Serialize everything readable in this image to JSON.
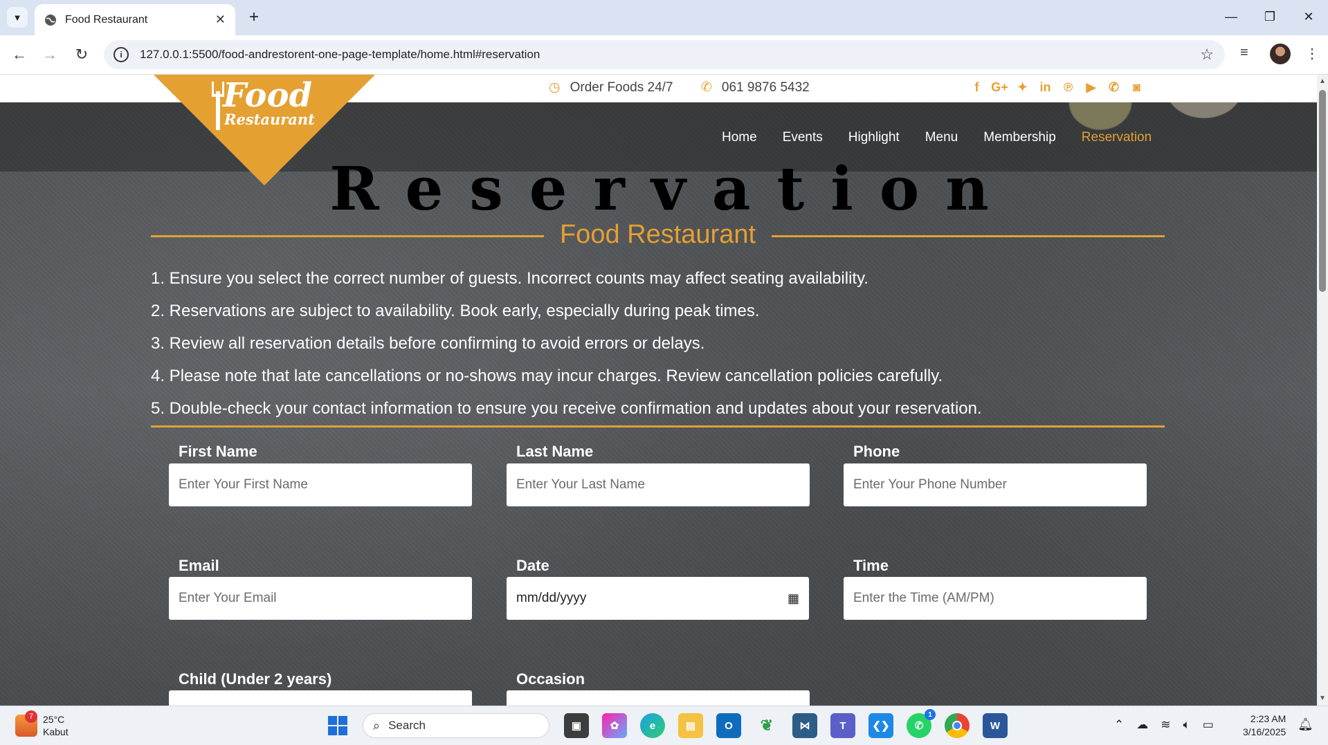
{
  "browser": {
    "tab_title": "Food Restaurant",
    "url": "127.0.0.1:5500/food-andrestorent-one-page-template/home.html#reservation"
  },
  "site": {
    "logo_word1": "Food",
    "logo_word2": "Restaurant",
    "topbar": {
      "order_text": "Order Foods 24/7",
      "phone": "061 9876 5432"
    },
    "social_icons": [
      "facebook-icon",
      "google-plus-icon",
      "twitter-icon",
      "linkedin-icon",
      "pinterest-icon",
      "youtube-icon",
      "phone-icon",
      "camera-icon"
    ],
    "nav": [
      "Home",
      "Events",
      "Highlight",
      "Menu",
      "Membership",
      "Reservation"
    ],
    "nav_active": "Reservation",
    "accent_color": "#e5a032"
  },
  "reservation": {
    "title": "Reservation",
    "subtitle": "Food Restaurant",
    "rules": [
      "1. Ensure you select the correct number of guests. Incorrect counts may affect seating availability.",
      "2. Reservations are subject to availability. Book early, especially during peak times.",
      "3. Review all reservation details before confirming to avoid errors or delays.",
      "4. Please note that late cancellations or no-shows may incur charges. Review cancellation policies carefully.",
      "5. Double-check your contact information to ensure you receive confirmation and updates about your reservation."
    ],
    "fields": {
      "first_name": {
        "label": "First Name",
        "placeholder": "Enter Your First Name"
      },
      "last_name": {
        "label": "Last Name",
        "placeholder": "Enter Your Last Name"
      },
      "phone": {
        "label": "Phone",
        "placeholder": "Enter Your Phone Number"
      },
      "email": {
        "label": "Email",
        "placeholder": "Enter Your Email"
      },
      "date": {
        "label": "Date",
        "value": "mm/dd/yyyy"
      },
      "time": {
        "label": "Time",
        "placeholder": "Enter the Time (AM/PM)"
      },
      "child": {
        "label": "Child (Under 2 years)"
      },
      "occasion": {
        "label": "Occasion"
      }
    }
  },
  "taskbar": {
    "weather_temp": "25°C",
    "weather_desc": "Kabut",
    "weather_badge": "7",
    "search_placeholder": "Search",
    "whatsapp_badge": "1",
    "time": "2:23 AM",
    "date": "3/16/2025"
  }
}
